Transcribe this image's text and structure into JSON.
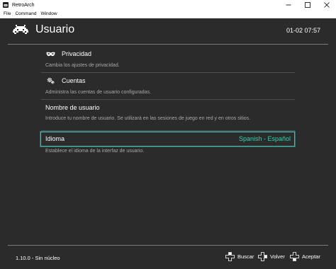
{
  "window": {
    "title": "RetroArch",
    "menu": [
      "File",
      "Command",
      "Window"
    ]
  },
  "header": {
    "title": "Usuario",
    "clock": "01-02 07:57"
  },
  "entries": [
    {
      "label": "Privacidad",
      "icon": "mask-icon",
      "sublabel": "Cambia los ajustes de privacidad."
    },
    {
      "label": "Cuentas",
      "icon": "gears-icon",
      "sublabel": "Administra las cuentas de usuario configuradas."
    },
    {
      "label": "Nombre de usuario",
      "sublabel": "Introduce tu nombre de usuario. Se utilizará en las sesiones de juego en red y en otros sitios."
    },
    {
      "label": "Idioma",
      "value": "Spanish - Español",
      "sublabel": "Establece el idioma de la interfaz de usuario."
    }
  ],
  "footer": {
    "version": "1.10.0 - Sin núcleo",
    "actions": [
      {
        "label": "Buscar",
        "icon": "dpad-icon"
      },
      {
        "label": "Volver",
        "icon": "dpad-icon"
      },
      {
        "label": "Aceptar",
        "icon": "dpad-icon"
      }
    ]
  },
  "colors": {
    "background": "#2b2b2b",
    "accent": "#4fb3a9",
    "value_text": "#2fd3ae"
  }
}
